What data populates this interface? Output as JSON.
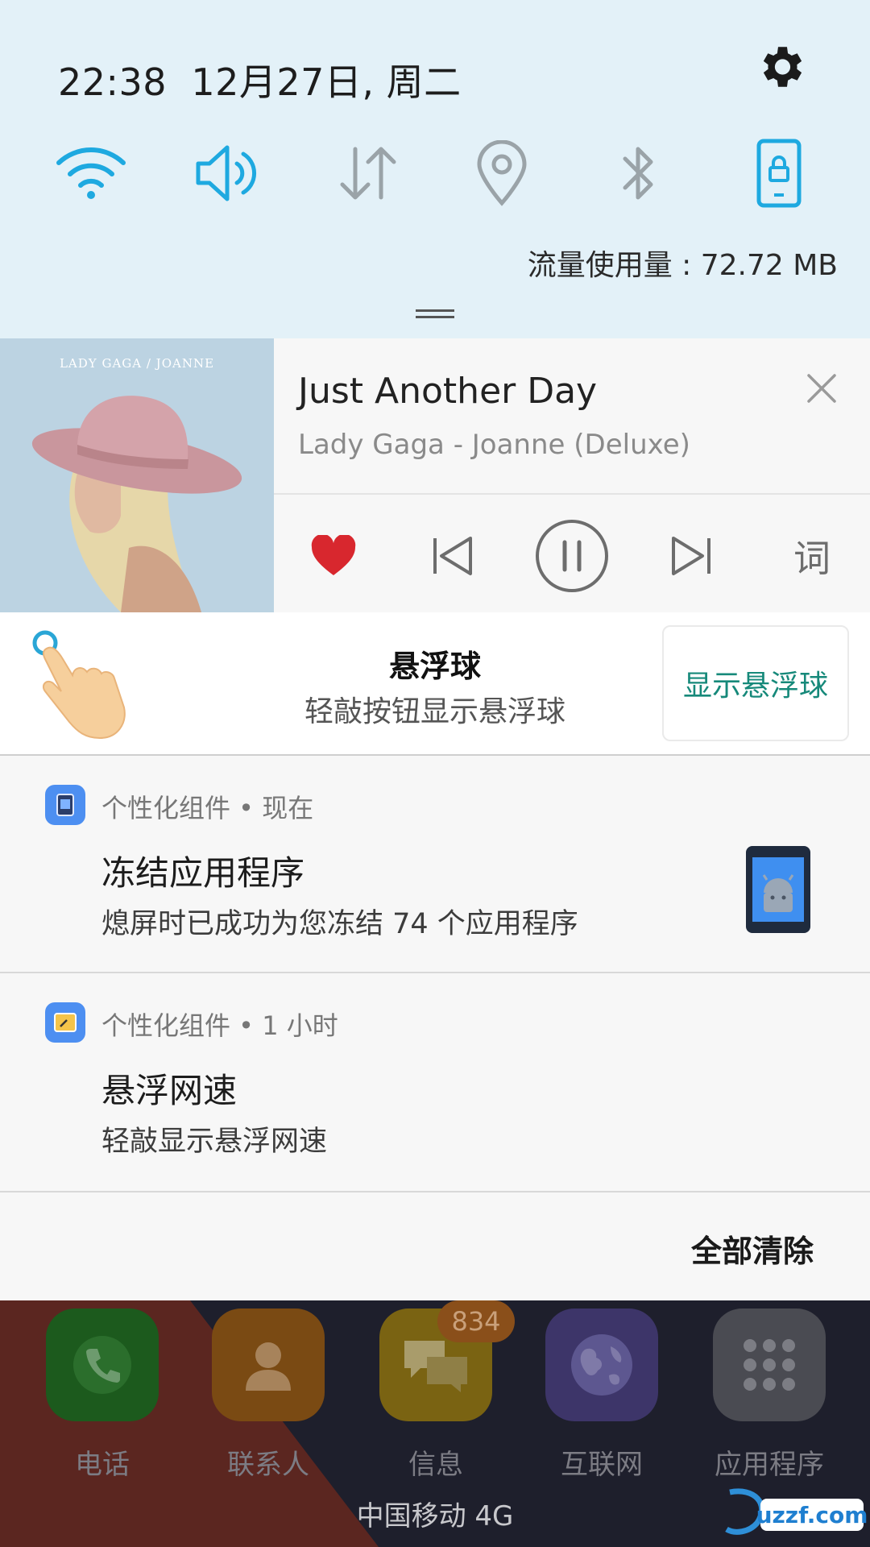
{
  "status": {
    "time": "22:38",
    "date": "12月27日, 周二"
  },
  "quick_toggles": [
    {
      "name": "wifi",
      "icon": "wifi-icon",
      "state": "on"
    },
    {
      "name": "sound",
      "icon": "volume-icon",
      "state": "on"
    },
    {
      "name": "mobile-data",
      "icon": "data-arrows-icon",
      "state": "off"
    },
    {
      "name": "location",
      "icon": "location-pin-icon",
      "state": "off"
    },
    {
      "name": "bluetooth",
      "icon": "bluetooth-icon",
      "state": "off"
    },
    {
      "name": "screen-lock",
      "icon": "rotation-lock-icon",
      "state": "on"
    }
  ],
  "data_usage": "流量使用量 : 72.72 MB",
  "colors": {
    "accent_on": "#1ea9e0",
    "toggle_off": "#9aa3a8",
    "heart": "#d8272e",
    "promo_button": "#16897a",
    "notif_icon": "#4d8ff1"
  },
  "music": {
    "album_text": "LADY GAGA / JOANNE",
    "title": "Just Another Day",
    "artist": "Lady Gaga - Joanne (Deluxe)",
    "lyrics_label": "词",
    "playback_state": "playing"
  },
  "promo": {
    "title": "悬浮球",
    "subtitle": "轻敲按钮显示悬浮球",
    "button": "显示悬浮球"
  },
  "notifications": [
    {
      "app": "个性化组件",
      "time": "现在",
      "header": "个性化组件 • 现在",
      "title": "冻结应用程序",
      "text": "熄屏时已成功为您冻结 74 个应用程序"
    },
    {
      "app": "个性化组件",
      "time": "1 小时",
      "header": "个性化组件 • 1 小时",
      "title": "悬浮网速",
      "text": "轻敲显示悬浮网速"
    }
  ],
  "clear_all": "全部清除",
  "dock": [
    {
      "label": "电话",
      "icon": "phone-icon",
      "color": "#1c5a1d"
    },
    {
      "label": "联系人",
      "icon": "contact-icon",
      "color": "#7a4a13"
    },
    {
      "label": "信息",
      "icon": "message-icon",
      "color": "#7a6312",
      "badge": "834"
    },
    {
      "label": "互联网",
      "icon": "globe-icon",
      "color": "#3d3569"
    },
    {
      "label": "应用程序",
      "icon": "apps-grid-icon",
      "color": "#4a4b52"
    }
  ],
  "carrier": "中国移动 4G",
  "watermark": "uzzf.com"
}
